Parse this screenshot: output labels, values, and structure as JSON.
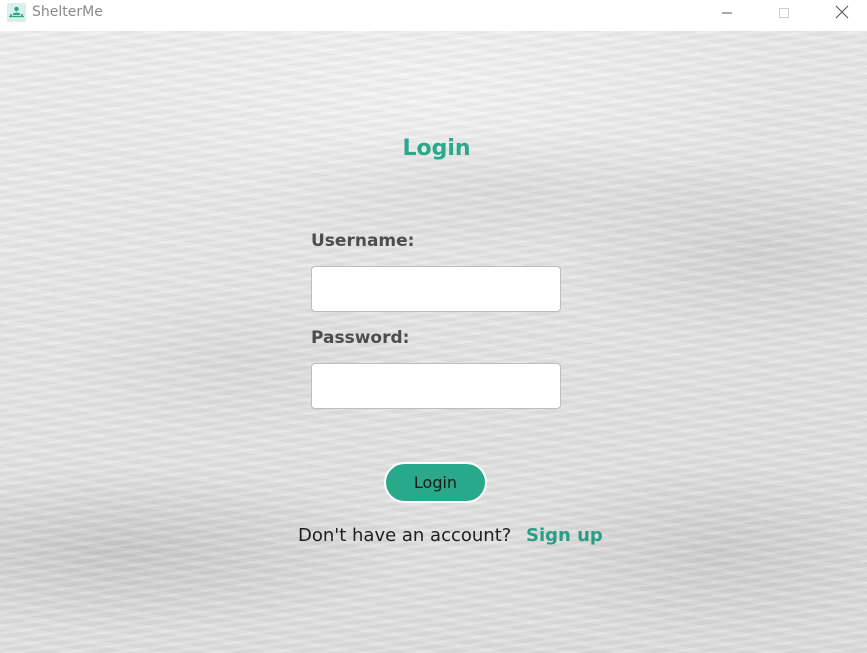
{
  "window": {
    "title": "ShelterMe",
    "app_icon": "shelterme-logo-icon",
    "controls": {
      "minimize_icon": "minimize-icon",
      "maximize_icon": "maximize-icon",
      "close_icon": "close-icon"
    }
  },
  "login": {
    "heading": "Login",
    "username_label": "Username:",
    "username_value": "",
    "password_label": "Password:",
    "password_value": "",
    "submit_label": "Login",
    "signup_prompt": "Don't have an account?",
    "signup_link": "Sign up"
  },
  "colors": {
    "accent": "#2aa88a",
    "link": "#2a9d86",
    "label": "#4d4d4d"
  }
}
